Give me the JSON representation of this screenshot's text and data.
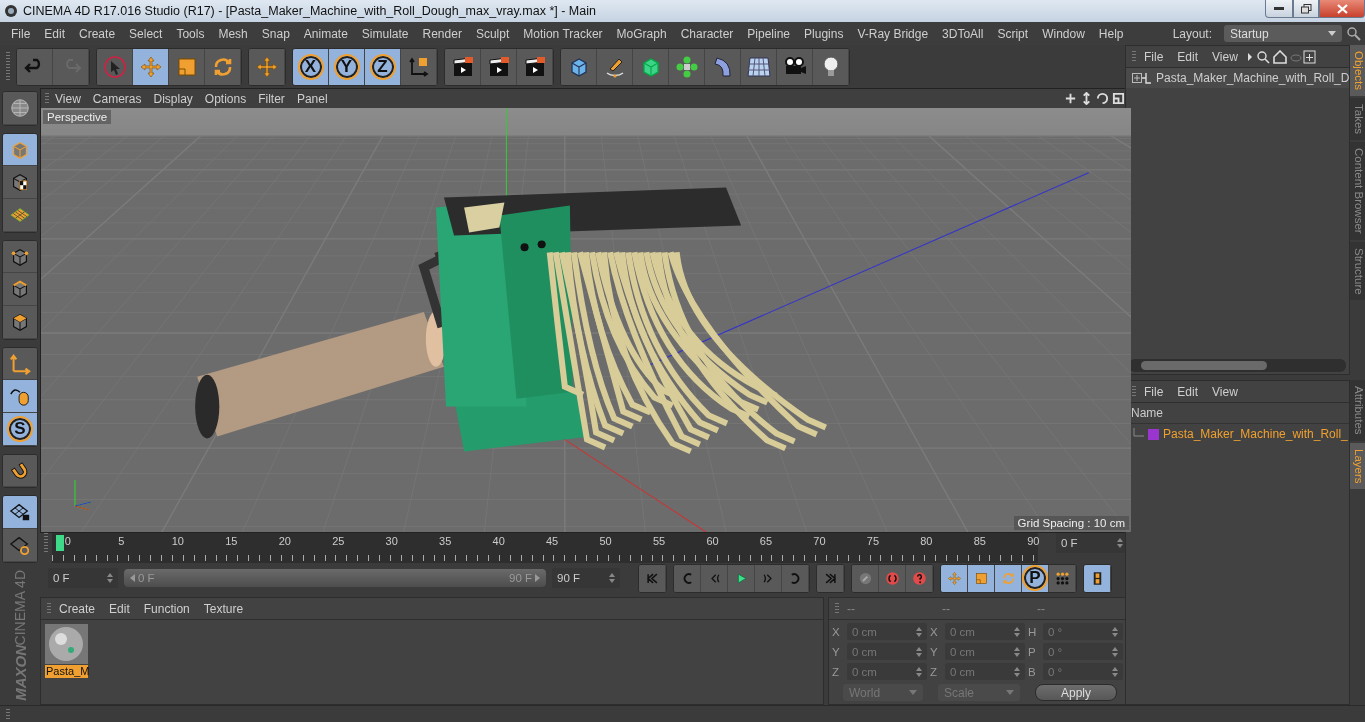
{
  "window": {
    "title": "CINEMA 4D R17.016 Studio (R17) - [Pasta_Maker_Machine_with_Roll_Dough_max_vray.max *] - Main"
  },
  "menu": [
    "File",
    "Edit",
    "Create",
    "Select",
    "Tools",
    "Mesh",
    "Snap",
    "Animate",
    "Simulate",
    "Render",
    "Sculpt",
    "Motion Tracker",
    "MoGraph",
    "Character",
    "Pipeline",
    "Plugins",
    "V-Ray Bridge",
    "3DToAll",
    "Script",
    "Window",
    "Help"
  ],
  "layout": {
    "label": "Layout:",
    "value": "Startup"
  },
  "toolbar": [
    {
      "buttons": [
        {
          "kind": "undo",
          "selected": false
        },
        {
          "kind": "redo",
          "selected": false
        }
      ]
    },
    {
      "buttons": [
        {
          "kind": "select",
          "selected": false
        },
        {
          "kind": "move",
          "selected": true
        },
        {
          "kind": "scale",
          "selected": false
        },
        {
          "kind": "rotate",
          "selected": false
        }
      ]
    },
    {
      "buttons": [
        {
          "kind": "move",
          "selected": false
        }
      ]
    },
    {
      "buttons": [
        {
          "kind": "letter",
          "label": "X",
          "selected": true
        },
        {
          "kind": "letter",
          "label": "Y",
          "selected": true
        },
        {
          "kind": "letter",
          "label": "Z",
          "selected": true
        },
        {
          "kind": "coord",
          "selected": false
        }
      ]
    },
    {
      "buttons": [
        {
          "kind": "clapper",
          "selected": false
        },
        {
          "kind": "clapper",
          "selected": false
        },
        {
          "kind": "clapper",
          "selected": false
        }
      ]
    },
    {
      "buttons": [
        {
          "kind": "cube",
          "selected": false
        },
        {
          "kind": "pen",
          "selected": false
        },
        {
          "kind": "greencube",
          "selected": false
        },
        {
          "kind": "cloner",
          "selected": false
        },
        {
          "kind": "bend",
          "selected": false
        },
        {
          "kind": "plane",
          "selected": false
        },
        {
          "kind": "camera",
          "selected": false
        },
        {
          "kind": "bulb",
          "selected": false
        }
      ]
    }
  ],
  "tool_strip": [
    {
      "buttons": [
        {
          "kind": "globe",
          "selected": false
        }
      ]
    },
    {
      "buttons": [
        {
          "kind": "modelcube",
          "selected": true
        },
        {
          "kind": "checker",
          "selected": false
        },
        {
          "kind": "orangegrid",
          "selected": false
        }
      ]
    },
    {
      "buttons": [
        {
          "kind": "points",
          "selected": false
        },
        {
          "kind": "edges",
          "selected": false
        },
        {
          "kind": "faces",
          "selected": false
        }
      ]
    },
    {
      "buttons": [
        {
          "kind": "axis",
          "selected": false
        },
        {
          "kind": "mouse",
          "selected": true
        },
        {
          "kind": "letter",
          "label": "S",
          "selected": true
        }
      ]
    },
    {
      "buttons": [
        {
          "kind": "magnet",
          "selected": false
        }
      ]
    },
    {
      "buttons": [
        {
          "kind": "lockgrid",
          "selected": true
        },
        {
          "kind": "gridcycle",
          "selected": false
        }
      ]
    }
  ],
  "viewport": {
    "menu": [
      "View",
      "Cameras",
      "Display",
      "Options",
      "Filter",
      "Panel"
    ],
    "camera": "Perspective",
    "grid_spacing": "Grid Spacing : 10 cm"
  },
  "timeline": {
    "ticks": [
      "0",
      "5",
      "10",
      "15",
      "20",
      "25",
      "30",
      "35",
      "40",
      "45",
      "50",
      "55",
      "60",
      "65",
      "70",
      "75",
      "80",
      "85",
      "90"
    ],
    "level": 0,
    "current_frame": "0 F"
  },
  "transport": {
    "start": "0 F",
    "range": {
      "start": "0 F",
      "end": "90 F",
      "level": 1
    },
    "end": "90 F",
    "groups": [
      {
        "buttons": [
          {
            "kind": "first",
            "selected": false
          }
        ]
      },
      {
        "buttons": [
          {
            "kind": "prevkey",
            "selected": false
          },
          {
            "kind": "prevframe",
            "selected": false
          },
          {
            "kind": "play",
            "selected": false
          },
          {
            "kind": "nextframe",
            "selected": false
          },
          {
            "kind": "nextkey",
            "selected": false
          }
        ]
      },
      {
        "buttons": [
          {
            "kind": "last",
            "selected": false
          }
        ]
      },
      {
        "buttons": [
          {
            "kind": "autokey",
            "selected": false
          },
          {
            "kind": "record",
            "selected": false
          },
          {
            "kind": "help",
            "selected": false
          }
        ]
      },
      {
        "buttons": [
          {
            "kind": "move",
            "selected": true
          },
          {
            "kind": "scale",
            "selected": true
          },
          {
            "kind": "rotate",
            "selected": true
          },
          {
            "kind": "letter",
            "label": "P",
            "selected": true
          },
          {
            "kind": "dots",
            "selected": false
          }
        ]
      },
      {
        "buttons": [
          {
            "kind": "film",
            "selected": true
          }
        ]
      }
    ]
  },
  "materials": {
    "menu": [
      "Create",
      "Edit",
      "Function",
      "Texture"
    ],
    "items": [
      {
        "name": "Pasta_M",
        "selected": true
      }
    ]
  },
  "coordinates": {
    "headers": [
      "--",
      "--",
      "--"
    ],
    "rows": [
      {
        "fields": [
          {
            "label": "X",
            "value": "0 cm"
          },
          {
            "label": "X",
            "value": "0 cm"
          },
          {
            "label": "H",
            "value": "0 °"
          }
        ]
      },
      {
        "fields": [
          {
            "label": "Y",
            "value": "0 cm"
          },
          {
            "label": "Y",
            "value": "0 cm"
          },
          {
            "label": "P",
            "value": "0 °"
          }
        ]
      },
      {
        "fields": [
          {
            "label": "Z",
            "value": "0 cm"
          },
          {
            "label": "Z",
            "value": "0 cm"
          },
          {
            "label": "B",
            "value": "0 °"
          }
        ]
      }
    ],
    "mode": "World",
    "transform": "Scale",
    "apply": "Apply"
  },
  "objects": {
    "menu": [
      "File",
      "Edit",
      "View"
    ],
    "items": [
      {
        "name": "Pasta_Maker_Machine_with_Roll_D",
        "expanded": false
      }
    ]
  },
  "layers": {
    "menu": [
      "File",
      "Edit",
      "View"
    ],
    "header": "Name",
    "items": [
      {
        "name": "Pasta_Maker_Machine_with_Roll_",
        "color": "#9b35d0"
      }
    ]
  },
  "side_tabs_top": [
    {
      "label": "Objects",
      "selected": true
    },
    {
      "label": "Takes",
      "selected": false
    },
    {
      "label": "Content Browser",
      "selected": false
    },
    {
      "label": "Structure",
      "selected": false
    }
  ],
  "side_tabs_bottom": [
    {
      "label": "Attributes",
      "selected": false
    },
    {
      "label": "Layers",
      "selected": true
    }
  ],
  "brand": {
    "maker": "MAXON",
    "product": "CINEMA 4D"
  }
}
